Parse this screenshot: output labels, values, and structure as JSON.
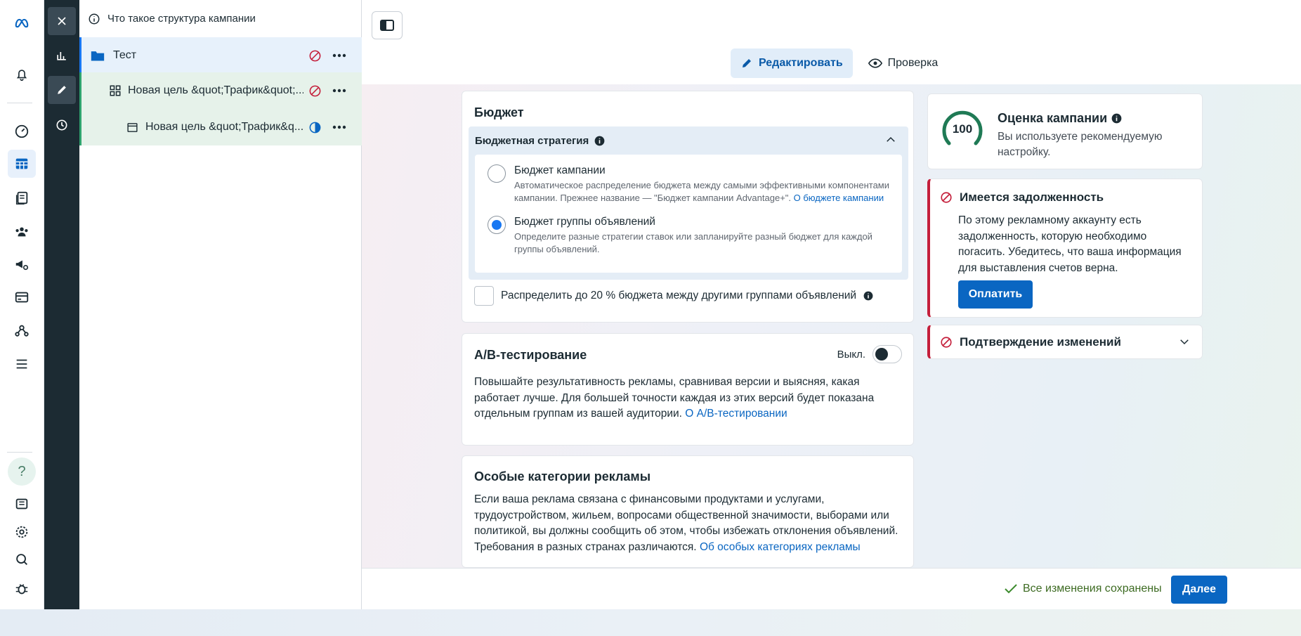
{
  "tree": {
    "header": "Что такое структура кампании",
    "campaign": "Тест",
    "adset": "Новая цель &quot;Трафик&quot;...",
    "ad": "Новая цель &quot;Трафик&q..."
  },
  "tabs": {
    "edit": "Редактировать",
    "review": "Проверка"
  },
  "budget": {
    "title": "Бюджет",
    "strategy_title": "Бюджетная стратегия",
    "option1_title": "Бюджет кампании",
    "option1_desc": "Автоматическое распределение бюджета между самыми эффективными компонентами кампании. Прежнее название — \"Бюджет кампании Advantage+\".",
    "option1_link": "О бюджете кампании",
    "option2_title": "Бюджет группы объявлений",
    "option2_desc": "Определите разные стратегии ставок или запланируйте разный бюджет для каждой группы объявлений.",
    "distribute_label": "Распределить до 20 % бюджета между другими группами объявлений"
  },
  "ab": {
    "title": "A/B-тестирование",
    "toggle_label": "Выкл.",
    "desc": "Повышайте результативность рекламы, сравнивая версии и выясняя, какая работает лучше. Для большей точности каждая из этих версий будет показана отдельным группам из вашей аудитории.",
    "link": "О A/B-тестировании"
  },
  "special": {
    "title": "Особые категории рекламы",
    "desc": "Если ваша реклама связана с финансовыми продуктами и услугами, трудоустройством, жильем, вопросами общественной значимости, выборами или политикой, вы должны сообщить об этом, чтобы избежать отклонения объявлений. Требования в разных странах различаются.",
    "link": "Об особых категориях рекламы"
  },
  "score": {
    "value": "100",
    "title": "Оценка кампании",
    "desc": "Вы используете рекомендуемую настройку."
  },
  "debt": {
    "title": "Имеется задолженность",
    "desc": "По этому рекламному аккаунту есть задолженность, которую необходимо погасить. Убедитесь, что ваша информация для выставления счетов верна.",
    "pay": "Оплатить"
  },
  "confirm": {
    "title": "Подтверждение изменений"
  },
  "footer": {
    "saved": "Все изменения сохранены",
    "next": "Далее"
  },
  "colors": {
    "accent": "#0a66c2",
    "error": "#c41e3a",
    "success": "#2fa36e",
    "dark": "#1c2b33"
  }
}
